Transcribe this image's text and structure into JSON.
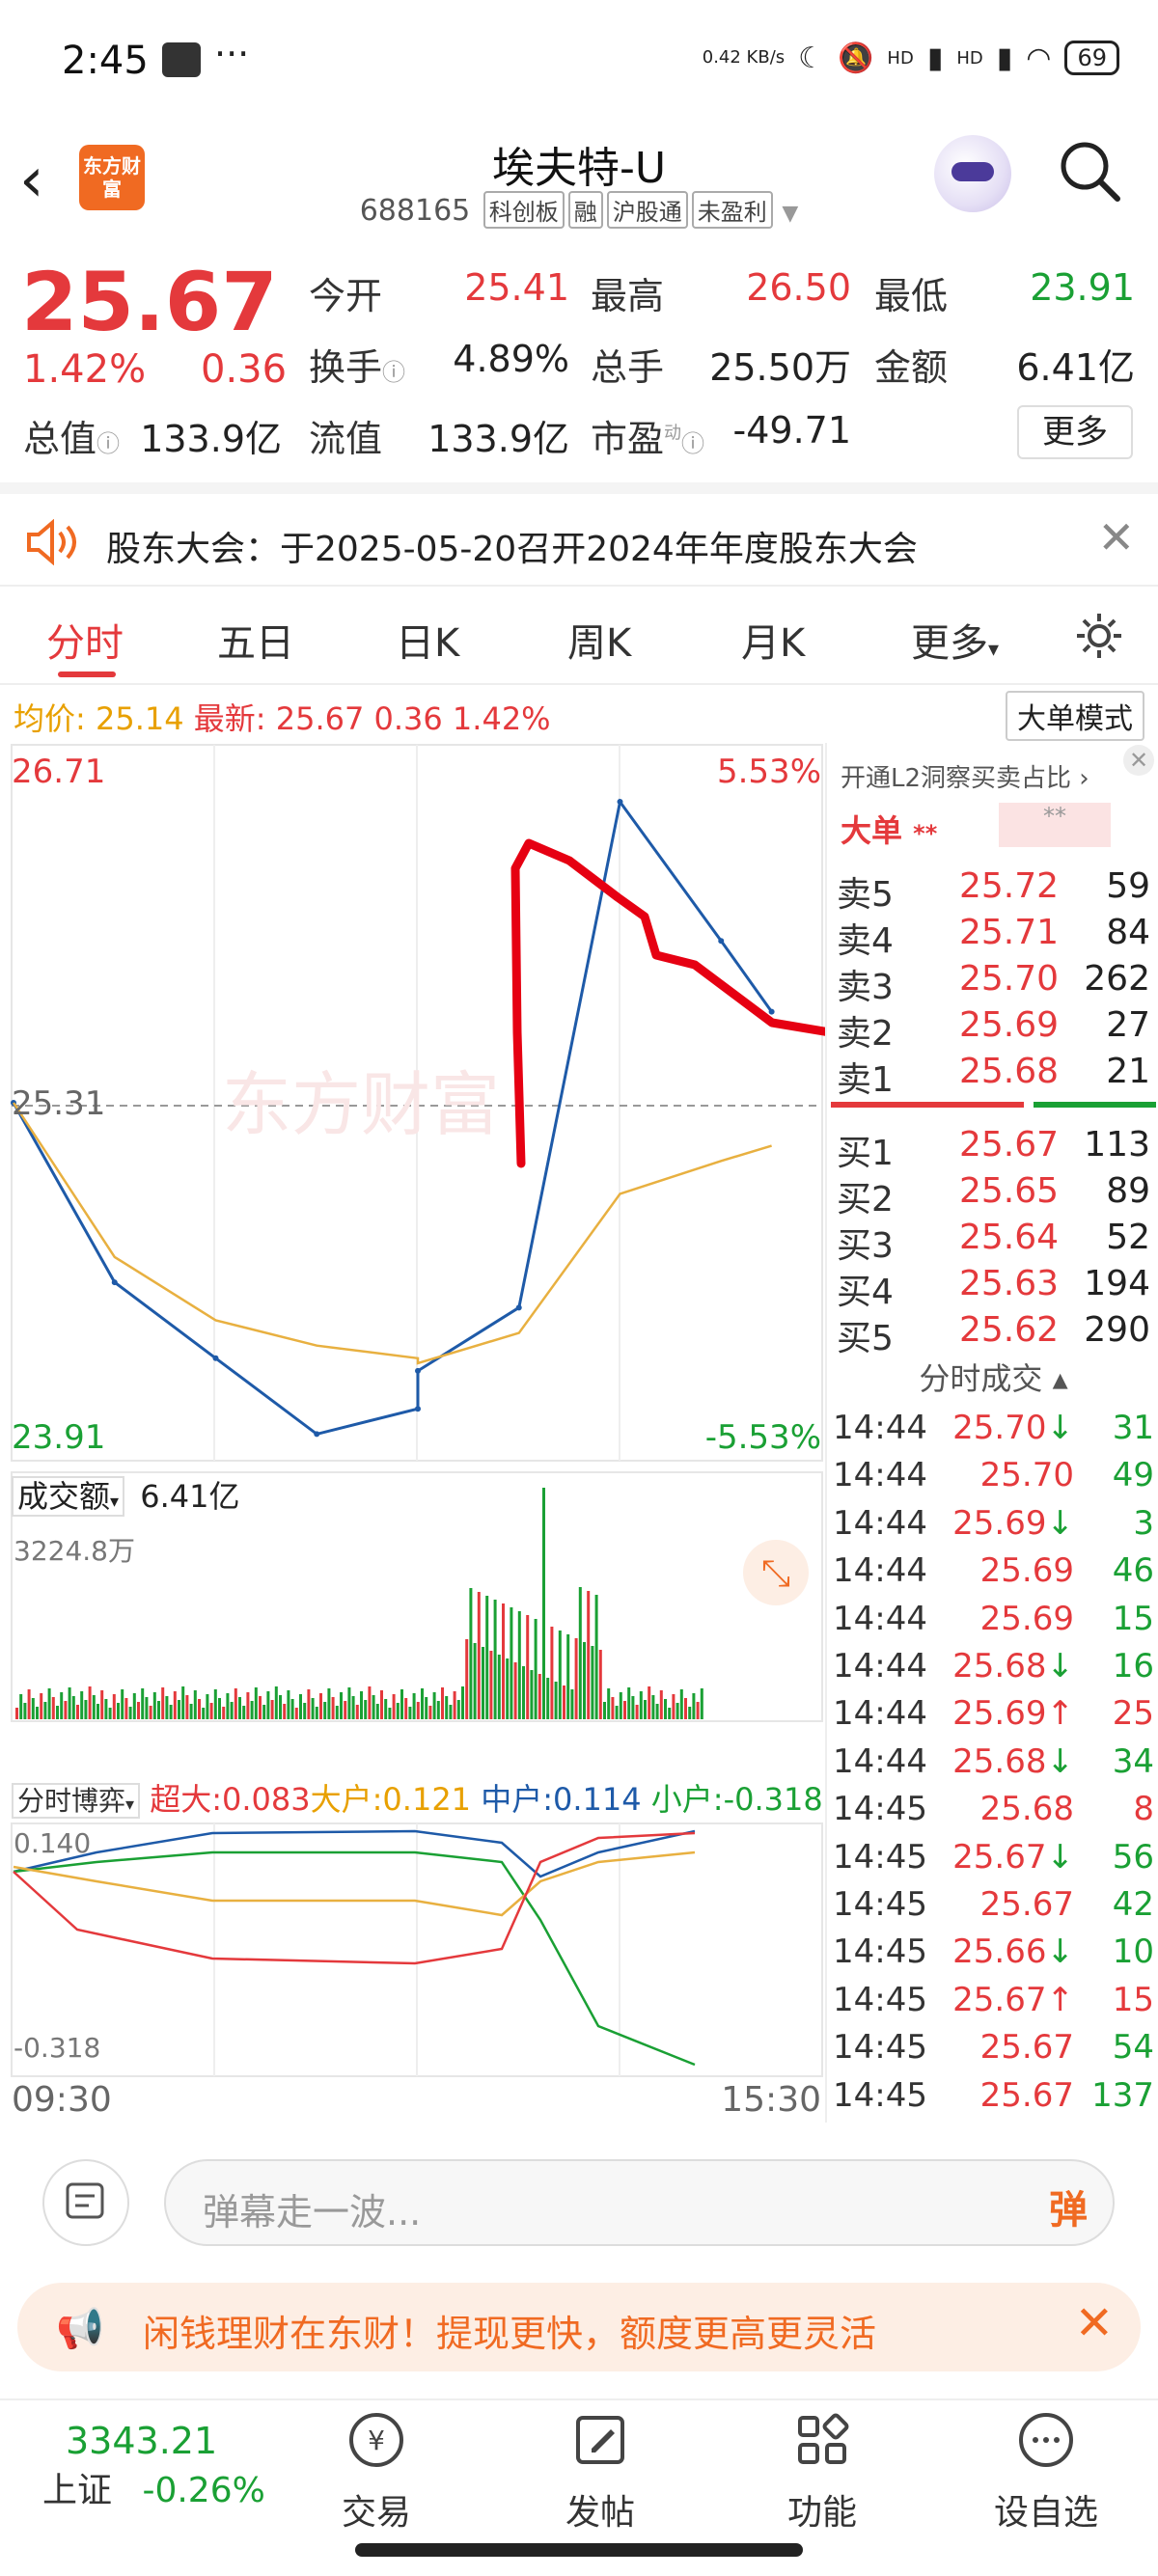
{
  "status_bar": {
    "time": "2:45",
    "net_speed": "0.42 KB/s",
    "signal1": "HD",
    "signal2": "HD",
    "battery": "69"
  },
  "header": {
    "title": "埃夫特-U",
    "code": "688165",
    "tags": [
      "科创板",
      "融",
      "沪股通",
      "未盈利"
    ],
    "logo_text": "东方财富"
  },
  "quote": {
    "price": "25.67",
    "change_pct": "1.42%",
    "change": "0.36",
    "fields": [
      {
        "label": "今开",
        "value": "25.41",
        "color": "red"
      },
      {
        "label": "最高",
        "value": "26.50",
        "color": "red"
      },
      {
        "label": "最低",
        "value": "23.91",
        "color": "green"
      },
      {
        "label": "换手",
        "value": "4.89%",
        "color": "black"
      },
      {
        "label": "总手",
        "value": "25.50万",
        "color": "black"
      },
      {
        "label": "金额",
        "value": "6.41亿",
        "color": "black"
      },
      {
        "label": "总值",
        "value": "133.9亿",
        "color": "black"
      },
      {
        "label": "流值",
        "value": "133.9亿",
        "color": "black"
      },
      {
        "label": "市盈",
        "value": "-49.71",
        "color": "black"
      }
    ],
    "more_button": "更多",
    "pe_superscript": "动"
  },
  "notice": {
    "text": "股东大会：于2025-05-20召开2024年年度股东大会"
  },
  "tabs": [
    "分时",
    "五日",
    "日K",
    "周K",
    "月K",
    "更多"
  ],
  "avg_line": {
    "avg_label": "均价:",
    "avg_value": "25.14",
    "latest_label": "最新:",
    "latest_value": "25.67",
    "change": "0.36",
    "change_pct": "1.42%",
    "big_mode": "大单模式"
  },
  "chart": {
    "y_high": "26.71",
    "y_mid": "25.31",
    "y_low": "23.91",
    "pct_high": "5.53%",
    "pct_low": "-5.53%",
    "volume_label": "成交额",
    "volume_total": "6.41亿",
    "volume_max": "3224.8万",
    "flow_label": "分时博弈",
    "flow_super": "超大:0.083",
    "flow_big": "大户:0.121",
    "flow_mid": "中户:0.114",
    "flow_small": "小户:-0.318",
    "flow_max": "0.140",
    "flow_min": "-0.318",
    "time_start": "09:30",
    "time_end": "15:30"
  },
  "chart_data": {
    "type": "line",
    "title": "",
    "xlabel": "",
    "ylabel": "",
    "ylim": [
      23.91,
      26.71
    ],
    "x": [
      "09:30",
      "10:00",
      "10:30",
      "11:00",
      "11:30",
      "13:00",
      "13:30",
      "14:00",
      "14:30",
      "14:45"
    ],
    "series": [
      {
        "name": "",
        "values": [
          25.31,
          24.6,
          24.3,
          24.0,
          24.1,
          24.25,
          24.5,
          26.5,
          25.95,
          25.67
        ]
      },
      {
        "name": "均价",
        "values": [
          25.31,
          24.7,
          24.45,
          24.35,
          24.3,
          24.28,
          24.4,
          24.95,
          25.08,
          25.14
        ]
      }
    ]
  },
  "order_book": {
    "l2_text": "开通L2洞察买卖占比",
    "big_order": "大单",
    "sells": [
      {
        "label": "卖5",
        "price": "25.72",
        "vol": "59"
      },
      {
        "label": "卖4",
        "price": "25.71",
        "vol": "84"
      },
      {
        "label": "卖3",
        "price": "25.70",
        "vol": "262"
      },
      {
        "label": "卖2",
        "price": "25.69",
        "vol": "27"
      },
      {
        "label": "卖1",
        "price": "25.68",
        "vol": "21"
      }
    ],
    "buys": [
      {
        "label": "买1",
        "price": "25.67",
        "vol": "113"
      },
      {
        "label": "买2",
        "price": "25.65",
        "vol": "89"
      },
      {
        "label": "买3",
        "price": "25.64",
        "vol": "52"
      },
      {
        "label": "买4",
        "price": "25.63",
        "vol": "194"
      },
      {
        "label": "买5",
        "price": "25.62",
        "vol": "290"
      }
    ],
    "ticks_header": "分时成交",
    "ticks": [
      {
        "time": "14:44",
        "price": "25.70↓",
        "vol": "31",
        "color": "green"
      },
      {
        "time": "14:44",
        "price": "25.70",
        "vol": "49",
        "color": "green"
      },
      {
        "time": "14:44",
        "price": "25.69↓",
        "vol": "3",
        "color": "green"
      },
      {
        "time": "14:44",
        "price": "25.69",
        "vol": "46",
        "color": "green"
      },
      {
        "time": "14:44",
        "price": "25.69",
        "vol": "15",
        "color": "green"
      },
      {
        "time": "14:44",
        "price": "25.68↓",
        "vol": "16",
        "color": "green"
      },
      {
        "time": "14:44",
        "price": "25.69↑",
        "vol": "25",
        "color": "red"
      },
      {
        "time": "14:44",
        "price": "25.68↓",
        "vol": "34",
        "color": "green"
      },
      {
        "time": "14:45",
        "price": "25.68",
        "vol": "8",
        "color": "red"
      },
      {
        "time": "14:45",
        "price": "25.67↓",
        "vol": "56",
        "color": "green"
      },
      {
        "time": "14:45",
        "price": "25.67",
        "vol": "42",
        "color": "green"
      },
      {
        "time": "14:45",
        "price": "25.66↓",
        "vol": "10",
        "color": "green"
      },
      {
        "time": "14:45",
        "price": "25.67↑",
        "vol": "15",
        "color": "red"
      },
      {
        "time": "14:45",
        "price": "25.67",
        "vol": "54",
        "color": "green"
      },
      {
        "time": "14:45",
        "price": "25.67",
        "vol": "137",
        "color": "green"
      }
    ]
  },
  "comment": {
    "placeholder": "弹幕走一波...",
    "danmu_button": "弹"
  },
  "promo": {
    "text": "闲钱理财在东财！提现更快，额度更高更灵活"
  },
  "bottom_nav": {
    "index_value": "3343.21",
    "index_name": "上证",
    "index_change": "-0.26%",
    "items": [
      "交易",
      "发帖",
      "功能",
      "设自选"
    ]
  }
}
